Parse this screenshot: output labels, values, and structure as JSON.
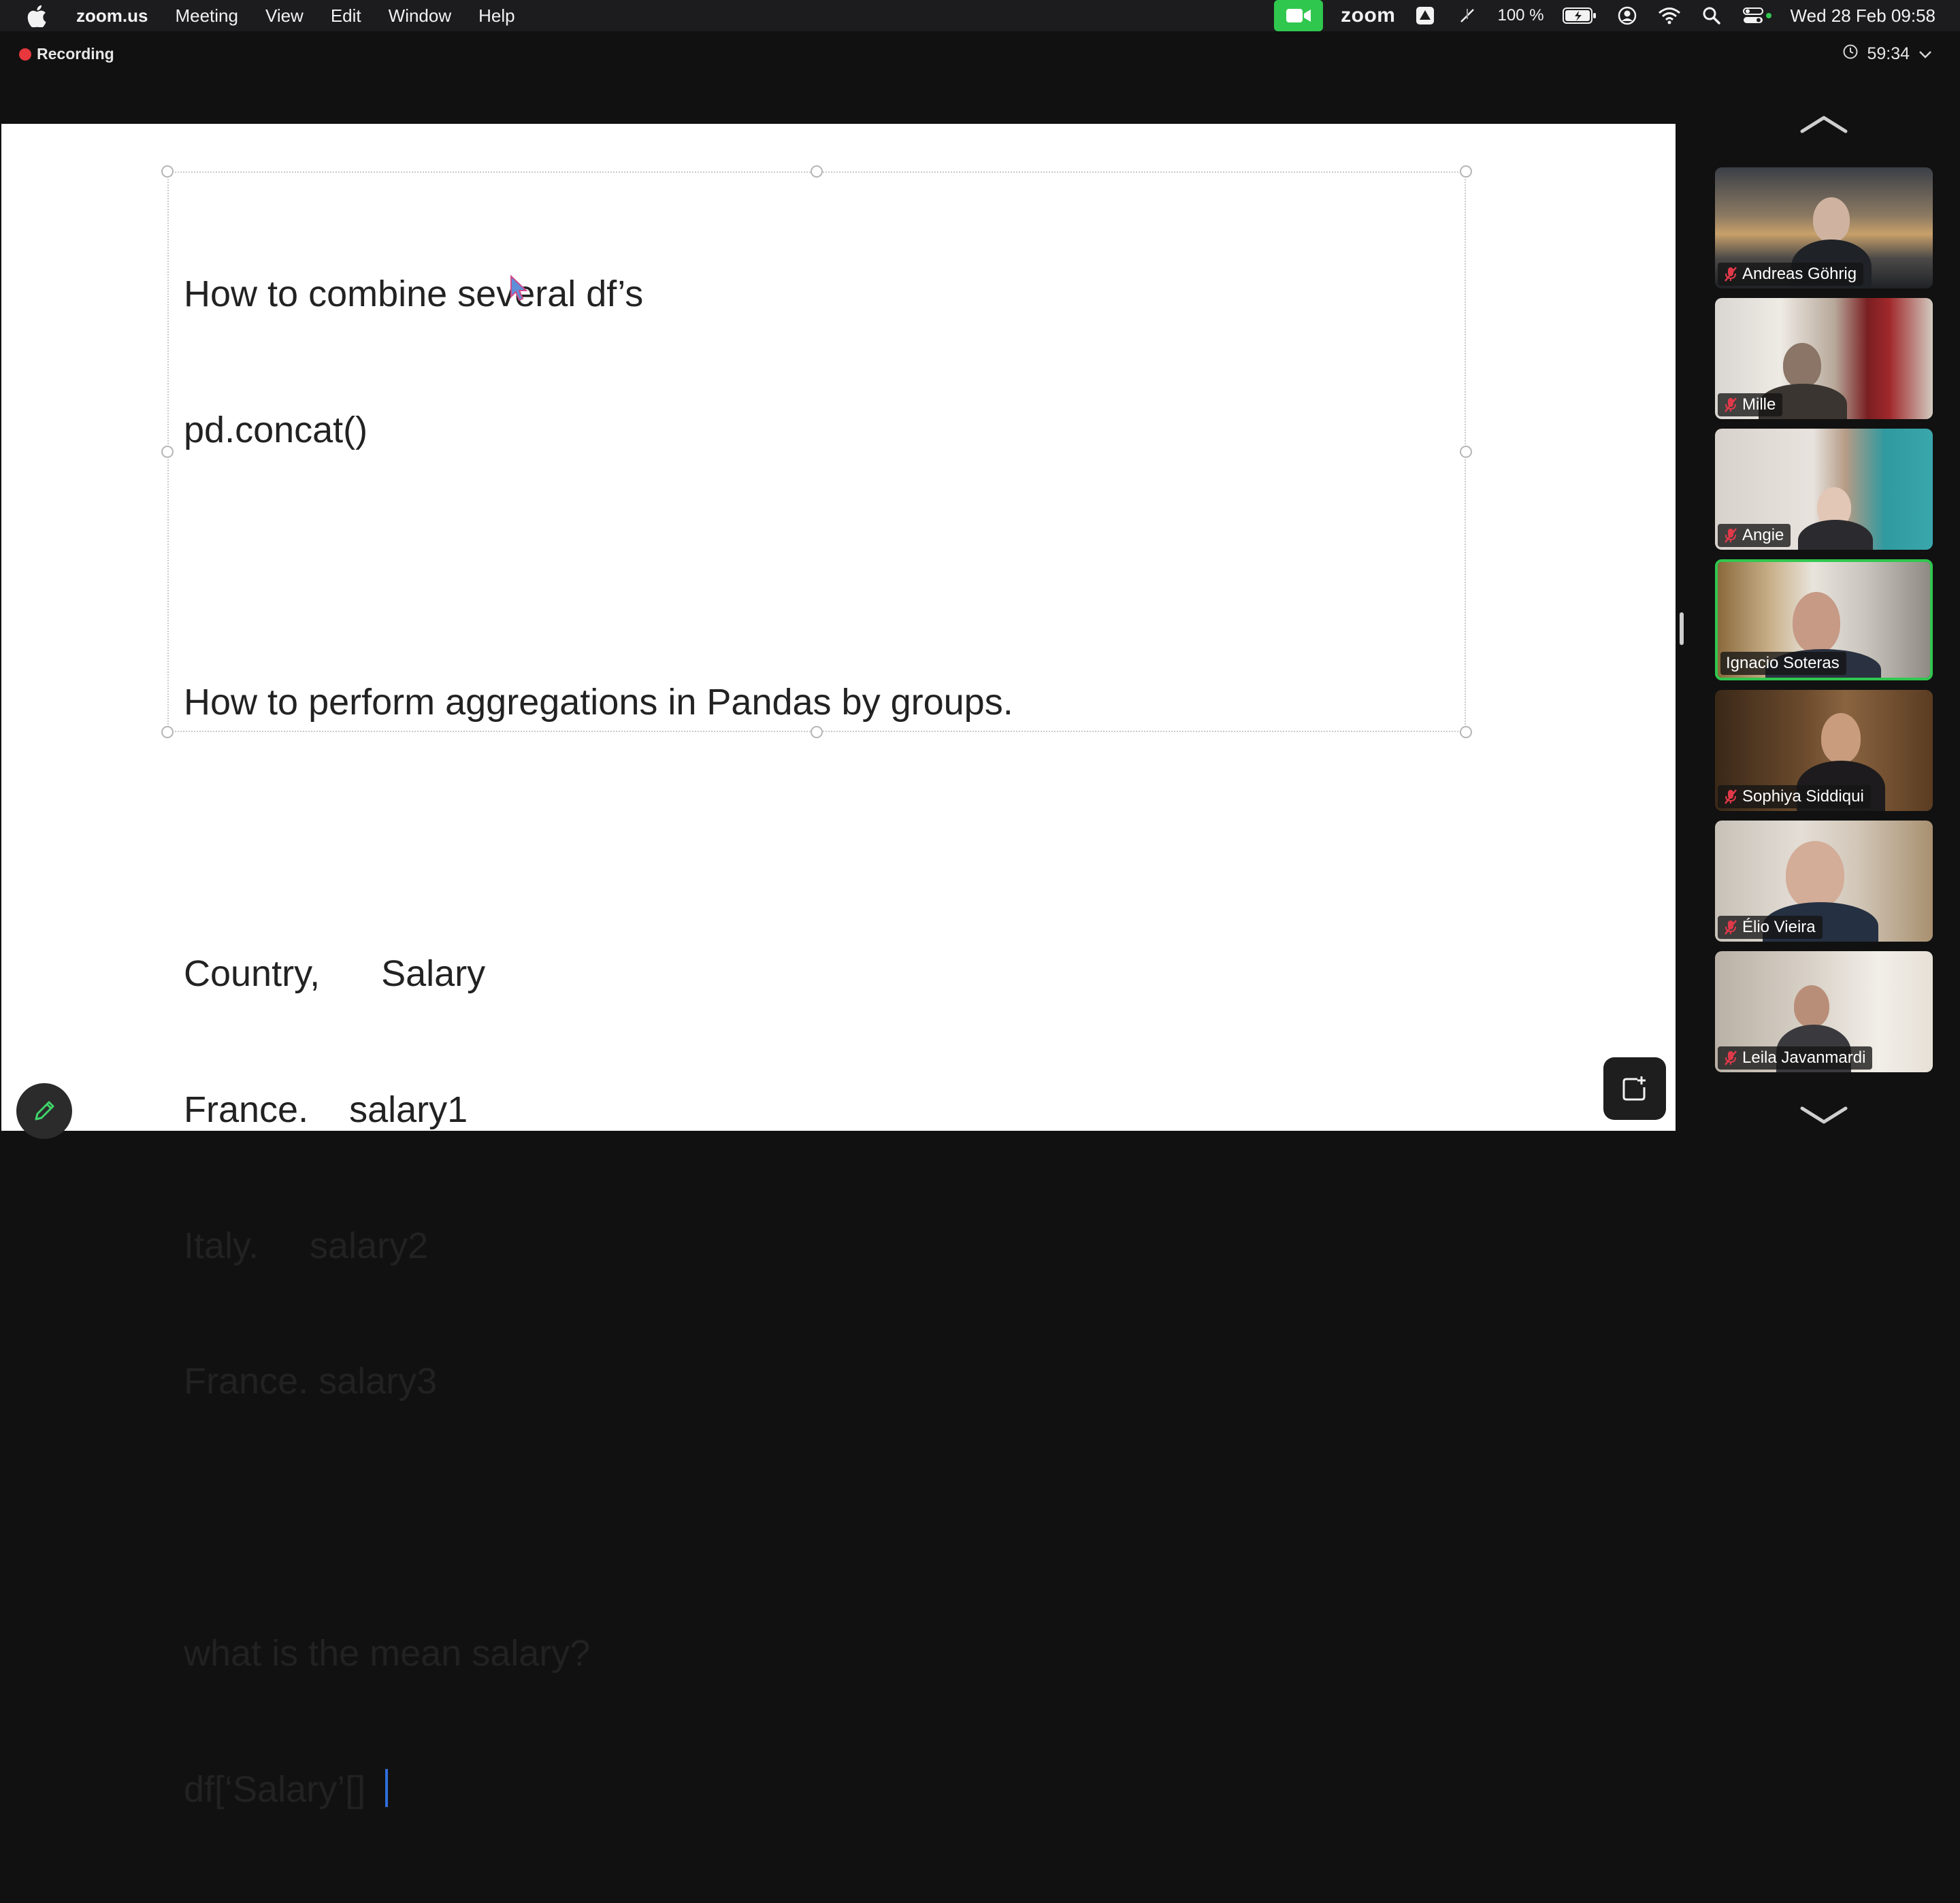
{
  "menubar": {
    "app_name": "zoom.us",
    "menus": [
      "Meeting",
      "View",
      "Edit",
      "Window",
      "Help"
    ],
    "zoom_label": "zoom",
    "battery": "100 %",
    "clock": "Wed 28 Feb  09:58"
  },
  "meeting": {
    "recording_label": "Recording",
    "timer": "59:34"
  },
  "document": {
    "lines": [
      "How to combine several df’s",
      "pd.concat()",
      "",
      "How to perform aggregations in Pandas by groups.",
      "",
      "Country,      Salary",
      "France.    salary1",
      "Italy.     salary2",
      "France. salary3",
      "",
      "what is the mean salary?",
      "df[‘Salary’[] "
    ]
  },
  "participants": [
    {
      "name": "Andreas Göhrig",
      "muted": true,
      "active": false
    },
    {
      "name": "Mille",
      "muted": true,
      "active": false
    },
    {
      "name": "Angie",
      "muted": true,
      "active": false
    },
    {
      "name": "Ignacio Soteras",
      "muted": false,
      "active": true
    },
    {
      "name": "Sophiya Siddiqui",
      "muted": true,
      "active": false
    },
    {
      "name": "Élio Vieira",
      "muted": true,
      "active": false
    },
    {
      "name": "Leila Javanmardi",
      "muted": true,
      "active": false
    }
  ],
  "colors": {
    "active_speaker": "#30c74f",
    "recording_dot": "#e8383d",
    "muted_mic": "#e0394a",
    "caret": "#2f6fdb"
  },
  "icons": {
    "apple": "apple-logo-icon",
    "camera": "video-camera-icon",
    "clock": "clock-icon",
    "pen": "pen-icon",
    "share": "share-screen-icon",
    "muted": "mic-muted-icon"
  }
}
